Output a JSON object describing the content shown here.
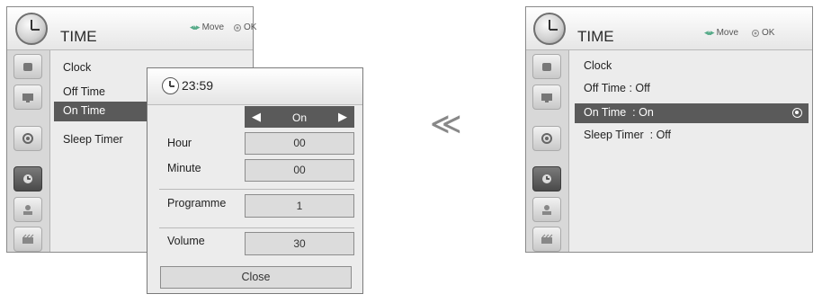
{
  "left_menu": {
    "title": "TIME",
    "hint_move": "Move",
    "hint_ok": "OK",
    "items": [
      "Clock",
      "Off Time",
      "On Time",
      "Sleep Timer"
    ],
    "selected_item": "On Time"
  },
  "popup": {
    "time": "23:59",
    "on_value": "On",
    "hour_label": "Hour",
    "hour_value": "00",
    "minute_label": "Minute",
    "minute_value": "00",
    "programme_label": "Programme",
    "programme_value": "1",
    "volume_label": "Volume",
    "volume_value": "30",
    "close_label": "Close"
  },
  "arrow_glyph": "≪",
  "right_menu": {
    "title": "TIME",
    "hint_move": "Move",
    "hint_ok": "OK",
    "items": [
      "Clock",
      "Off Time  : Off",
      "On Time  : On",
      "Sleep Timer  : Off"
    ],
    "selected_item": "On Time  : On"
  },
  "side_icons": [
    "picture-icon",
    "screen-icon",
    "audio-icon",
    "time-icon",
    "option-icon",
    "input-icon"
  ],
  "colors": {
    "highlight": "#5a5a5a",
    "panel": "#ececec",
    "sidebar": "#d8d8d8"
  }
}
